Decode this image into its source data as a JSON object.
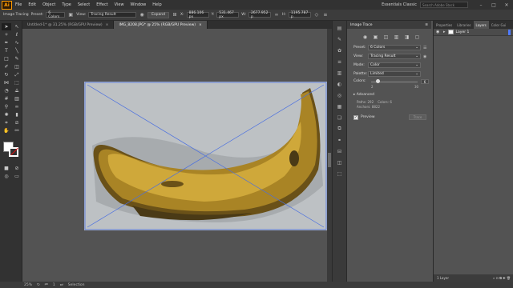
{
  "menubar": {
    "logo": "Ai",
    "items": [
      "File",
      "Edit",
      "Object",
      "Type",
      "Select",
      "Effect",
      "View",
      "Window",
      "Help"
    ],
    "workspace": "Essentials Classic",
    "search_placeholder": "Search Adobe Stock"
  },
  "controlbar": {
    "mode_label": "Image Tracing",
    "preset_label": "Preset:",
    "preset_value": "6 Colors",
    "view_label": "View:",
    "view_value": "Tracing Result",
    "expand_label": "Expand",
    "x_value": "886.106 px",
    "y_value": "531.467 px",
    "w_value": "2677.952 p",
    "h_value": "1195.787 p"
  },
  "doc_tabs": [
    {
      "label": "Untitled-1* @ 31.25% (RGB/GPU Preview)",
      "active": false
    },
    {
      "label": "IMG_8208.JPG* @ 25% (RGB/GPU Preview)",
      "active": true
    }
  ],
  "image_trace": {
    "title": "Image Trace",
    "preset_label": "Preset:",
    "preset_value": "6 Colors",
    "view_label": "View:",
    "view_value": "Tracing Result",
    "mode_label": "Mode:",
    "mode_value": "Color",
    "palette_label": "Palette:",
    "palette_value": "Limited",
    "colors_label": "Colors:",
    "colors_value": "6",
    "colors_min": "2",
    "colors_max": "30",
    "colors_fraction": 0.14,
    "advanced_label": "Advanced",
    "paths_label": "Paths:",
    "paths_value": "292",
    "colors_info_label": "Colors:",
    "colors_info_value": "6",
    "anchors_label": "Anchors:",
    "anchors_value": "8822",
    "preview_label": "Preview",
    "trace_label": "Trace"
  },
  "layers": {
    "tabs": [
      "Properties",
      "Libraries",
      "Layers",
      "Color Gui"
    ],
    "active_tab": "Layers",
    "layer_name": "Layer 1",
    "footer": "1 Layer"
  },
  "status": {
    "zoom": "25%",
    "page": "1",
    "tool": "Selection"
  },
  "colors": {
    "banana_light": "#cfa83a",
    "banana_mid": "#a98425",
    "banana_dark": "#6a5118",
    "shadow": "#4a3a16",
    "background_gray": "#bdc1c4",
    "selection_blue": "#4a6fe0",
    "layer_color": "#4f7bff"
  }
}
